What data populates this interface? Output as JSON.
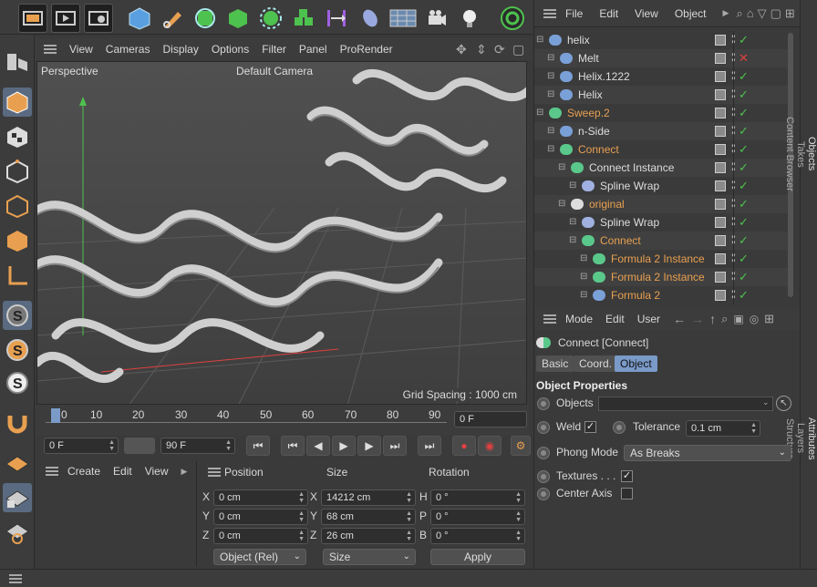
{
  "viewport": {
    "menu": [
      "View",
      "Cameras",
      "Display",
      "Options",
      "Filter",
      "Panel",
      "ProRender"
    ],
    "label_left": "Perspective",
    "label_right": "Default Camera",
    "grid_spacing": "Grid Spacing : 1000 cm"
  },
  "timeline": {
    "ticks": [
      "0",
      "10",
      "20",
      "30",
      "40",
      "50",
      "60",
      "70",
      "80",
      "90"
    ],
    "current_frame": "0 F",
    "start_frame": "0 F",
    "end_frame": "90 F"
  },
  "bottom_left_menu": [
    "Create",
    "Edit",
    "View"
  ],
  "coords": {
    "headers": [
      "Position",
      "Size",
      "Rotation"
    ],
    "rows": [
      {
        "axis": "X",
        "pos": "0 cm",
        "size_axis": "X",
        "size": "14212 cm",
        "rot_axis": "H",
        "rot": "0 °"
      },
      {
        "axis": "Y",
        "pos": "0 cm",
        "size_axis": "Y",
        "size": "68 cm",
        "rot_axis": "P",
        "rot": "0 °"
      },
      {
        "axis": "Z",
        "pos": "0 cm",
        "size_axis": "Z",
        "size": "26 cm",
        "rot_axis": "B",
        "rot": "0 °"
      }
    ],
    "mode_select": "Object (Rel)",
    "size_select": "Size",
    "apply_label": "Apply"
  },
  "object_manager": {
    "menu": [
      "File",
      "Edit",
      "View",
      "Object"
    ],
    "tabs": [
      "Objects",
      "Takes",
      "Content Browser"
    ],
    "items": [
      {
        "name": "helix",
        "indent": 0,
        "color": "#ddd",
        "icon": "#7aa0d8"
      },
      {
        "name": "Melt",
        "indent": 1,
        "color": "#ddd",
        "icon": "#7aa0d8",
        "x": true
      },
      {
        "name": "Helix.1222",
        "indent": 1,
        "color": "#ddd",
        "icon": "#7aa0d8"
      },
      {
        "name": "Helix",
        "indent": 1,
        "color": "#ddd",
        "icon": "#7aa0d8"
      },
      {
        "name": "Sweep.2",
        "indent": 0,
        "color": "#e8a050",
        "icon": "#5ac88a"
      },
      {
        "name": "n-Side",
        "indent": 1,
        "color": "#ddd",
        "icon": "#7aa0d8"
      },
      {
        "name": "Connect",
        "indent": 1,
        "color": "#e8a050",
        "icon": "#5ac88a"
      },
      {
        "name": "Connect Instance",
        "indent": 2,
        "color": "#ddd",
        "icon": "#5ac88a"
      },
      {
        "name": "Spline Wrap",
        "indent": 3,
        "color": "#ddd",
        "icon": "#a0b0e0"
      },
      {
        "name": "original",
        "indent": 2,
        "color": "#e8a050",
        "icon": "#ddd"
      },
      {
        "name": "Spline Wrap",
        "indent": 3,
        "color": "#ddd",
        "icon": "#a0b0e0"
      },
      {
        "name": "Connect",
        "indent": 3,
        "color": "#e8a050",
        "icon": "#5ac88a"
      },
      {
        "name": "Formula 2 Instance",
        "indent": 4,
        "color": "#e8a050",
        "icon": "#5ac88a"
      },
      {
        "name": "Formula 2 Instance",
        "indent": 4,
        "color": "#e8a050",
        "icon": "#5ac88a"
      },
      {
        "name": "Formula 2",
        "indent": 4,
        "color": "#e8a050",
        "icon": "#7aa0d8"
      }
    ]
  },
  "attributes": {
    "menu": [
      "Mode",
      "Edit",
      "User"
    ],
    "tabs_side": [
      "Attributes",
      "Layers",
      "Structure"
    ],
    "title": "Connect [Connect]",
    "tabs": [
      "Basic",
      "Coord.",
      "Object"
    ],
    "section": "Object Properties",
    "objects_label": "Objects",
    "weld_label": "Weld",
    "tolerance_label": "Tolerance",
    "tolerance_value": "0.1 cm",
    "phong_label": "Phong Mode",
    "phong_value": "As Breaks",
    "textures_label": "Textures . . .",
    "center_label": "Center Axis"
  }
}
